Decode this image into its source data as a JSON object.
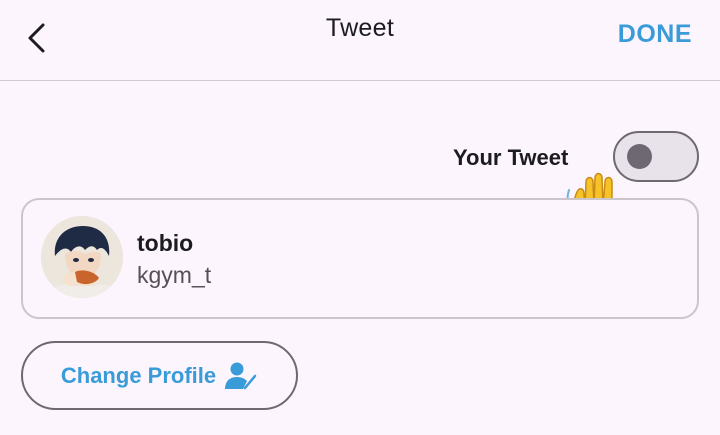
{
  "header": {
    "title": "Tweet",
    "done_label": "DONE"
  },
  "toggle": {
    "label": "Your Tweet",
    "state": "off"
  },
  "profile": {
    "name": "tobio",
    "handle": "kgym_t"
  },
  "actions": {
    "change_profile_label": "Change Profile"
  },
  "icons": {
    "back": "chevron-left-icon",
    "waving_hands": "waving-hands-icon",
    "edit_user": "edit-user-icon"
  },
  "colors": {
    "accent": "#3a9bd9",
    "background": "#fcf5fd",
    "text": "#1c1b1f",
    "secondary_text": "#555058",
    "outline": "#6e6873"
  }
}
